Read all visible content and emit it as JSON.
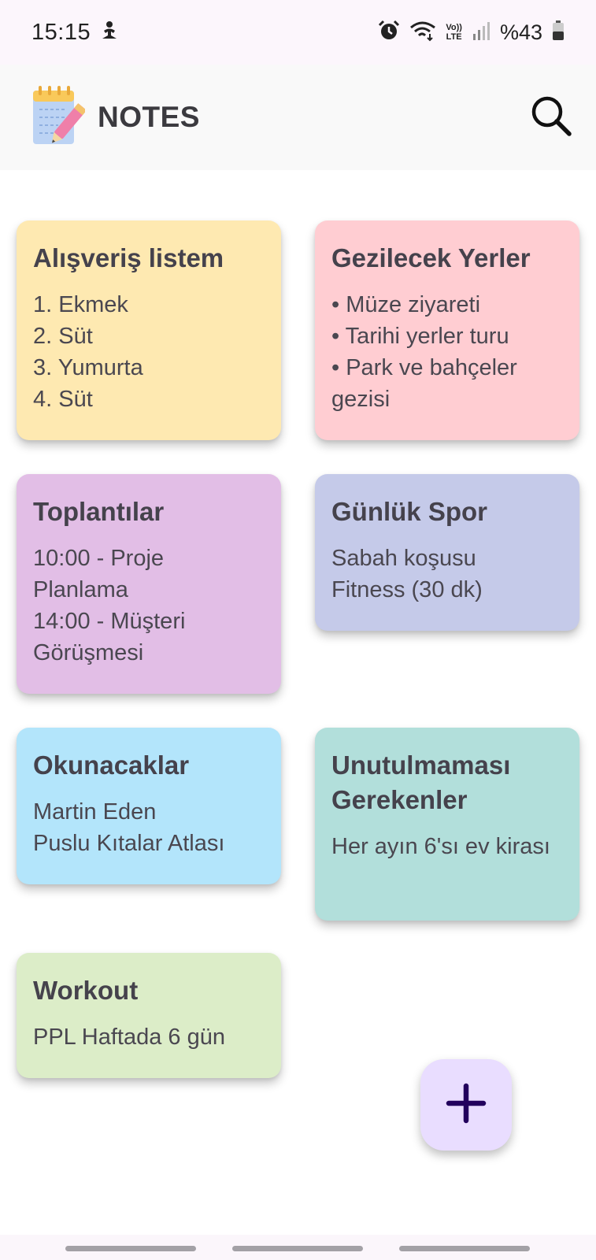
{
  "status_bar": {
    "time": "15:15",
    "battery_text": "%43",
    "network_label_top": "Vo))",
    "network_label_bottom": "LTE"
  },
  "app_bar": {
    "title": "NOTES",
    "logo_icon": "notepad-pencil-icon",
    "search_icon": "search-icon"
  },
  "notes": [
    {
      "title": "Alışveriş listem",
      "body": "1. Ekmek\n2. Süt\n3. Yumurta\n4. Süt",
      "color": "#fee9b1"
    },
    {
      "title": "Gezilecek Yerler",
      "body": "• Müze ziyareti\n• Tarihi yerler turu\n• Park ve bahçeler gezisi",
      "color": "#ffcdd2"
    },
    {
      "title": "Toplantılar",
      "body": "10:00 - Proje Planlama\n14:00 - Müşteri Görüşmesi",
      "color": "#e2bee6"
    },
    {
      "title": "Günlük Spor",
      "body": "Sabah koşusu\nFitness (30 dk)",
      "color": "#c5cae9"
    },
    {
      "title": "Okunacaklar",
      "body": "Martin Eden\nPuslu Kıtalar Atlası",
      "color": "#b3e5fb"
    },
    {
      "title": "Unutulmaması Gerekenler",
      "body": "Her ayın 6'sı ev kirası",
      "color": "#b2dfdb"
    },
    {
      "title": "Workout",
      "body": "PPL Haftada 6 gün",
      "color": "#dcedc8"
    }
  ],
  "fab": {
    "icon": "plus-icon",
    "color": "#e9ddff"
  }
}
